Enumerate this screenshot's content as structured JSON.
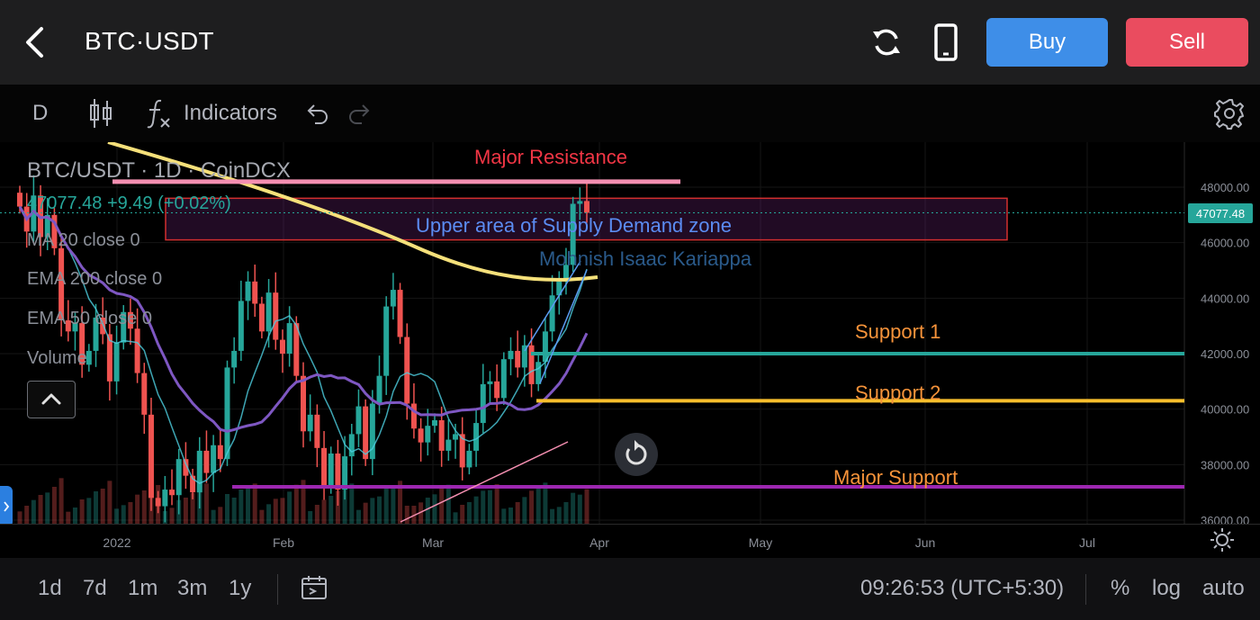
{
  "header": {
    "pair": "BTC·USDT",
    "buy_label": "Buy",
    "sell_label": "Sell"
  },
  "toolbar": {
    "interval": "D",
    "indicators_label": "Indicators"
  },
  "legend": {
    "title": "BTC/USDT · 1D · CoinDCX",
    "price_line": "47077.48  +9.49 (+0.02%)",
    "ma": "MA 20 close 0",
    "ema200": "EMA 200 close 0",
    "ema50": "EMA 50 close 0",
    "volume": "Volume"
  },
  "annotations": {
    "major_resistance": "Major Resistance",
    "supply_zone": "Upper area of Supply Demand zone",
    "author": "Mohnish Isaac Kariappa",
    "support1": "Support 1",
    "support2": "Support 2",
    "major_support": "Major Support"
  },
  "price_axis": {
    "ticks": [
      "48000.00",
      "46000.00",
      "44000.00",
      "42000.00",
      "40000.00",
      "38000.00",
      "36000.00"
    ],
    "current": "47077.48"
  },
  "time_axis": {
    "ticks": [
      "2022",
      "Feb",
      "Mar",
      "Apr",
      "May",
      "Jun",
      "Jul"
    ]
  },
  "bottom_bar": {
    "ranges": [
      "1d",
      "7d",
      "1m",
      "3m",
      "1y"
    ],
    "clock": "09:26:53 (UTC+5:30)",
    "percent": "%",
    "log": "log",
    "auto": "auto"
  },
  "colors": {
    "up": "#26a69a",
    "down": "#ef5350",
    "resistance": "#f48fb1",
    "support1": "#26a69a",
    "support2": "#fbc02d",
    "major_support": "#9c27b0",
    "ema200": "#f5e07a",
    "ma20": "#4dd0e1",
    "ema50": "#7e57c2",
    "buy": "#3e8ee8",
    "sell": "#ea4c5f"
  },
  "chart_data": {
    "type": "candlestick",
    "levels": {
      "major_resistance": 48200,
      "supply_zone": [
        46100,
        47600
      ],
      "support1": 42000,
      "support2": 40300,
      "major_support": 37200
    },
    "current_price": 47077.48,
    "ylim": [
      36000,
      49000
    ],
    "close_series": [
      47300,
      46400,
      47700,
      46200,
      47000,
      45800,
      43200,
      42800,
      43100,
      41600,
      42100,
      43300,
      42700,
      41000,
      42400,
      43500,
      42900,
      41300,
      39800,
      36800,
      36500,
      37100,
      36900,
      38200,
      37600,
      37000,
      38500,
      37700,
      38700,
      38200,
      41500,
      42100,
      43900,
      44600,
      43800,
      42800,
      44200,
      42500,
      42000,
      43100,
      41200,
      39200,
      39800,
      38600,
      37200,
      38400,
      37100,
      38300,
      39100,
      40100,
      38200,
      40200,
      41200,
      43700,
      44300,
      42600,
      40200,
      39300,
      38800,
      39400,
      39600,
      38500,
      38900,
      39100,
      37900,
      38500,
      39500,
      40900,
      41000,
      40400,
      41800,
      42100,
      41500,
      42300,
      40900,
      41700,
      42800,
      44100,
      44600,
      45200,
      47400,
      47500,
      47077
    ]
  }
}
